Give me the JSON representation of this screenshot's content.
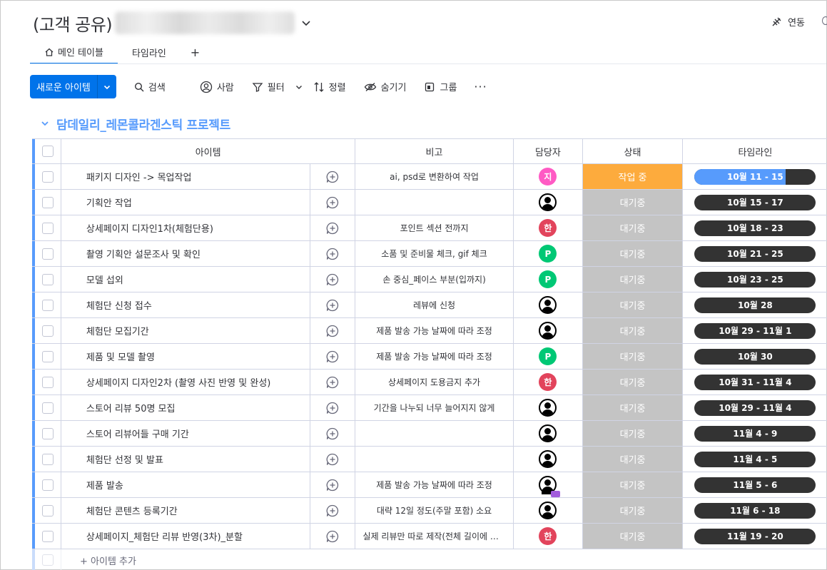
{
  "board": {
    "title": "(고객 공유)",
    "integrate_label": "연동"
  },
  "tabs": [
    {
      "label": "메인 테이블",
      "icon": "home-icon"
    },
    {
      "label": "타임라인"
    }
  ],
  "tab_add": "+",
  "toolbar": {
    "new_item": "새로운 아이템",
    "search": "검색",
    "person": "사람",
    "filter": "필터",
    "sort": "정렬",
    "hide": "숨기기",
    "group": "그룹",
    "more": "···"
  },
  "group": {
    "title": "담데일리_레몬콜라겐스틱 프로젝트",
    "color": "#579bfc"
  },
  "columns": {
    "item": "아이템",
    "note": "비고",
    "person": "담당자",
    "status": "상태",
    "timeline": "타임라인"
  },
  "rows": [
    {
      "name": "패키지 디자인 -> 목업작업",
      "note": "ai, psd로 변환하여 작업",
      "avatar": "지",
      "avatar_color": "#ff5ac4",
      "status": "작업 중",
      "status_type": "working",
      "timeline": "10월 11 - 15",
      "timeline_progress": 0.75
    },
    {
      "name": "기획안 작업",
      "note": "",
      "avatar": "",
      "avatar_color": "",
      "status": "대기중",
      "status_type": "waiting",
      "timeline": "10월 15 - 17",
      "timeline_progress": 0
    },
    {
      "name": "상세페이지 디자인1차(체험단용)",
      "note": "포인트 섹션 전까지",
      "avatar": "한",
      "avatar_color": "#e2445c",
      "status": "대기중",
      "status_type": "waiting",
      "timeline": "10월 18 - 23",
      "timeline_progress": 0
    },
    {
      "name": "촬영 기획안 설문조사 및 확인",
      "note": "소품 및 준비물 체크, gif 체크",
      "avatar": "P",
      "avatar_color": "#00c875",
      "status": "대기중",
      "status_type": "waiting",
      "timeline": "10월 21 - 25",
      "timeline_progress": 0
    },
    {
      "name": "모델 섭외",
      "note": "손 중심_페이스 부분(입까지)",
      "avatar": "P",
      "avatar_color": "#00c875",
      "status": "대기중",
      "status_type": "waiting",
      "timeline": "10월 23 - 25",
      "timeline_progress": 0
    },
    {
      "name": "체험단 신청 접수",
      "note": "레뷰에 신청",
      "avatar": "",
      "avatar_color": "",
      "status": "대기중",
      "status_type": "waiting",
      "timeline": "10월 28",
      "timeline_progress": 0
    },
    {
      "name": "체험단 모집기간",
      "note": "제품 발송 가능 날짜에 따라 조정",
      "avatar": "",
      "avatar_color": "",
      "status": "대기중",
      "status_type": "waiting",
      "timeline": "10월 29 - 11월 1",
      "timeline_progress": 0
    },
    {
      "name": "제품 및 모델 촬영",
      "note": "제품 발송 가능 날짜에 따라 조정",
      "avatar": "P",
      "avatar_color": "#00c875",
      "status": "대기중",
      "status_type": "waiting",
      "timeline": "10월 30",
      "timeline_progress": 0
    },
    {
      "name": "상세페이지 디자인2차 (촬영 사진 반영 및 완성)",
      "note": "상세페이지 도용금지 추가",
      "avatar": "한",
      "avatar_color": "#e2445c",
      "status": "대기중",
      "status_type": "waiting",
      "timeline": "10월 31 - 11월 4",
      "timeline_progress": 0
    },
    {
      "name": "스토어 리뷰 50명 모집",
      "note": "기간을 나누되 너무 늘어지지 않게",
      "avatar": "",
      "avatar_color": "",
      "status": "대기중",
      "status_type": "waiting",
      "timeline": "10월 29 - 11월 4",
      "timeline_progress": 0
    },
    {
      "name": "스토어 리뷰어들 구매 기간",
      "note": "",
      "avatar": "",
      "avatar_color": "",
      "status": "대기중",
      "status_type": "waiting",
      "timeline": "11월 4 - 9",
      "timeline_progress": 0
    },
    {
      "name": "체험단 선정 및 발표",
      "note": "",
      "avatar": "",
      "avatar_color": "",
      "status": "대기중",
      "status_type": "waiting",
      "timeline": "11월 4 - 5",
      "timeline_progress": 0
    },
    {
      "name": "제품 발송",
      "note": "제품 발송 가능 날짜에 따라 조정",
      "avatar": "",
      "avatar_color": "",
      "avatar_badge": true,
      "status": "대기중",
      "status_type": "waiting",
      "timeline": "11월 5 - 6",
      "timeline_progress": 0
    },
    {
      "name": "체험단 콘텐츠 등록기간",
      "note": "대략 12일 정도(주말 포함) 소요",
      "avatar": "",
      "avatar_color": "",
      "status": "대기중",
      "status_type": "waiting",
      "timeline": "11월 6 - 18",
      "timeline_progress": 0
    },
    {
      "name": "상세페이지_체험단 리뷰 반영(3차)_분할",
      "note": "실제 리뷰만 따로 제작(전체 길이에 포...",
      "avatar": "한",
      "avatar_color": "#e2445c",
      "status": "대기중",
      "status_type": "waiting",
      "timeline": "11월 19 - 20",
      "timeline_progress": 0
    }
  ],
  "add_item": "+ 아이템 추가",
  "colors": {
    "accent": "#0073ea",
    "working": "#fdab3d",
    "waiting": "#c4c4c4",
    "timeline_dark": "#333333",
    "timeline_fill": "#579bfc"
  }
}
